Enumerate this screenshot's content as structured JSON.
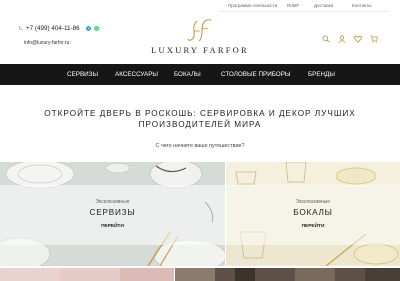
{
  "top_links": [
    "Программа лояльности",
    "RuMF",
    "Доставка",
    "Контакты"
  ],
  "contacts": {
    "phone": "+7 (499) 404-11-86",
    "email": "info@luxury-farfor.ru"
  },
  "logo": {
    "monogram": "LF",
    "name": "LUXURY FARFOR"
  },
  "nav": [
    "СЕРВИЗЫ",
    "АКСЕССУАРЫ",
    "БОКАЛЫ",
    "СТОЛОВЫЕ ПРИБОРЫ",
    "БРЕНДЫ"
  ],
  "headline": "ОТКРОЙТЕ ДВЕРЬ В РОСКОШЬ: СЕРВИРОВКА И ДЕКОР ЛУЧШИХ ПРОИЗВОДИТЕЛЕЙ МИРА",
  "question": "С чего начнете ваше путешествие?",
  "categories": [
    {
      "small": "Эксклюзивные",
      "title": "СЕРВИЗЫ",
      "button": "ПЕРЕЙТИ"
    },
    {
      "small": "Эксклюзивные",
      "title": "БОКАЛЫ",
      "button": "ПЕРЕЙТИ"
    }
  ],
  "colors": {
    "nav_bg": "#161616",
    "gold": "#b8923e",
    "viber": "#7b519d",
    "whatsapp": "#25d366"
  }
}
